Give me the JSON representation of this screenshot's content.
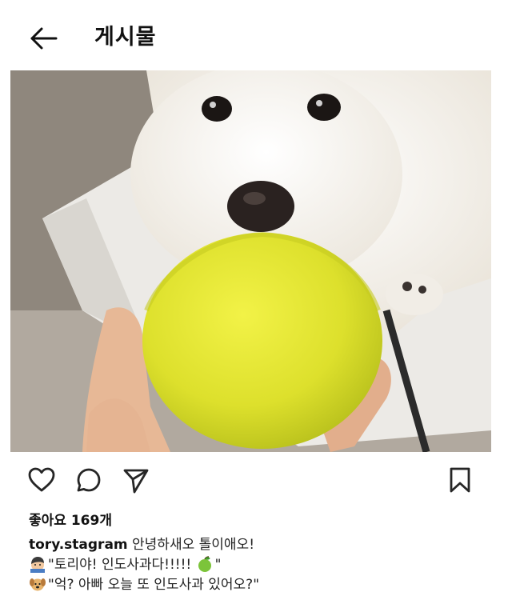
{
  "header": {
    "back_icon": "arrow-left-icon",
    "title": "게시물"
  },
  "post": {
    "photo_subject": "photo",
    "actions": {
      "like_icon": "heart-icon",
      "comment_icon": "comment-icon",
      "share_icon": "paper-plane-icon",
      "save_icon": "bookmark-icon"
    },
    "likes": "좋아요 169개",
    "caption": {
      "username": "tory.stagram",
      "text": "안녕하새오 톨이애오!",
      "line2": "\"토리야! 인도사과다!!!!! ",
      "line2_end": "\"",
      "line3": "\"억? 아빠 오늘 또 인도사과 있어오?\""
    }
  },
  "colors": {
    "text": "#262626",
    "icon": "#262626",
    "apple": "#d8dc2a",
    "dog": "#f4f1ea"
  }
}
